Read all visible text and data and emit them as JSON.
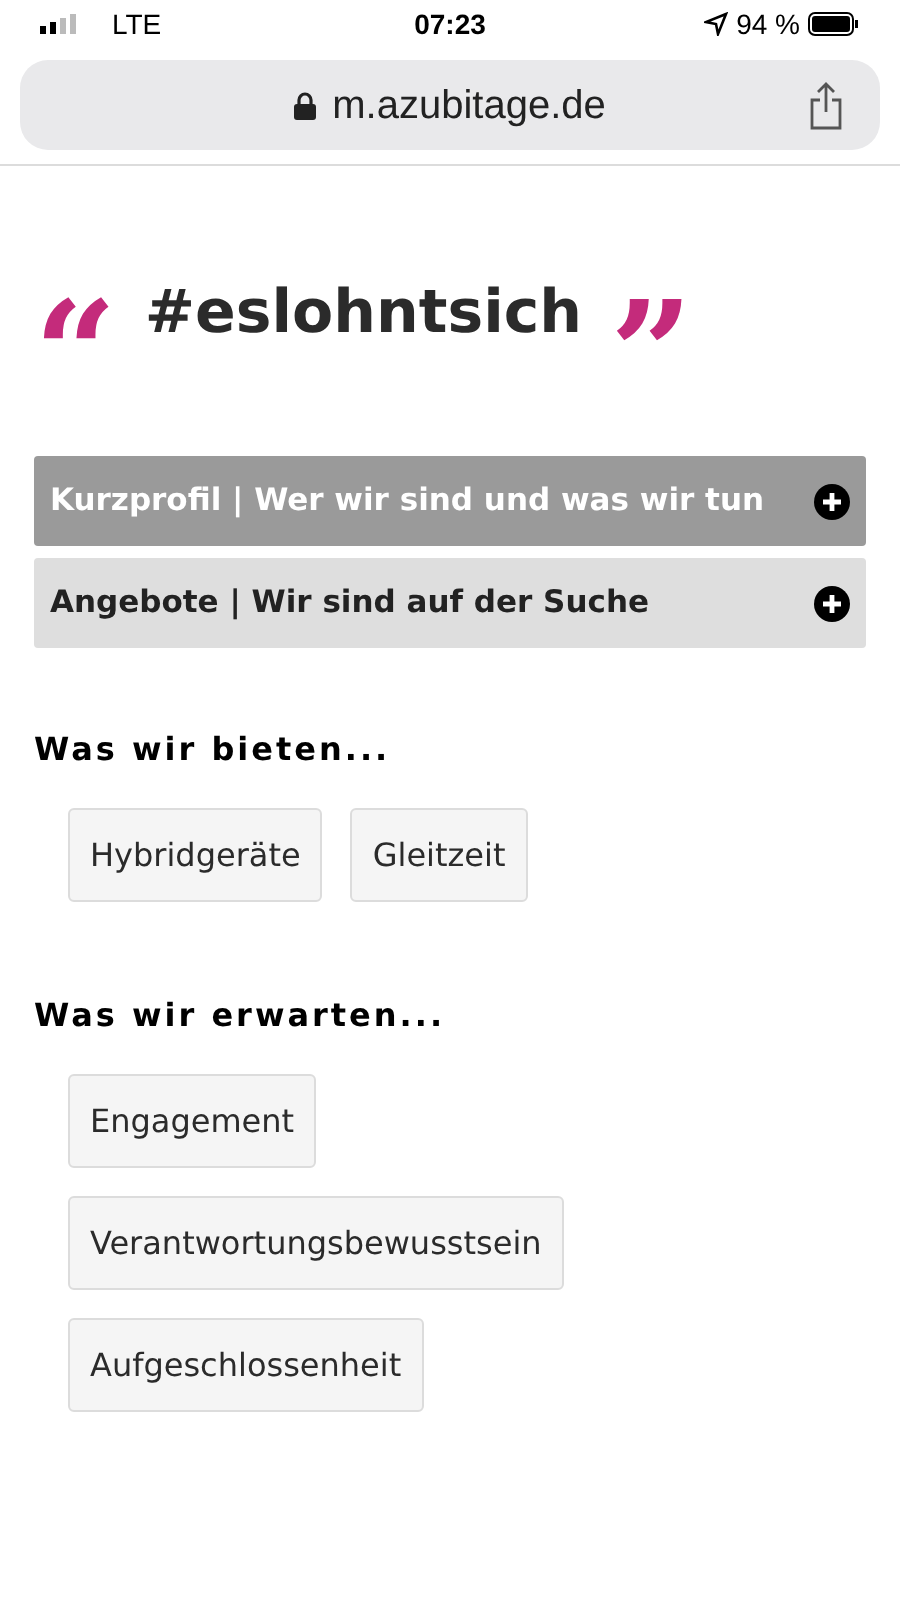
{
  "status_bar": {
    "carrier": "LTE",
    "time": "07:23",
    "battery": "94 %"
  },
  "address_bar": {
    "url": "m.azubitage.de"
  },
  "heading": {
    "open_quote": "“",
    "title": "#eslohntsich",
    "close_quote": "”"
  },
  "accordion": [
    {
      "label": "Kurzprofil | Wer wir sind und was wir tun",
      "selected": true
    },
    {
      "label": "Angebote | Wir sind auf der Suche",
      "selected": false
    }
  ],
  "sections": [
    {
      "title": "Was wir bieten...",
      "kind": "row",
      "tags": [
        "Hybridgeräte",
        "Gleitzeit"
      ]
    },
    {
      "title": "Was wir erwarten...",
      "kind": "column",
      "tags": [
        "Engagement",
        "Verantwortungsbewusstsein",
        "Aufgeschlossenheit"
      ]
    }
  ]
}
